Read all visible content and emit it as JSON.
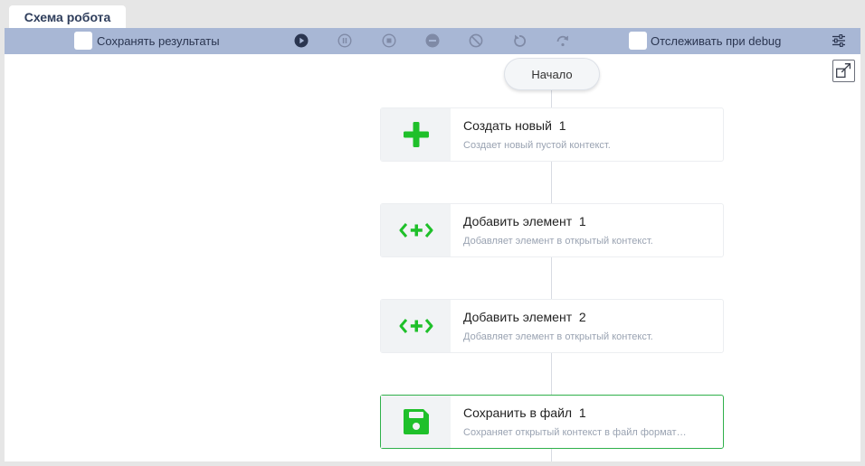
{
  "tab": {
    "label": "Схема робота"
  },
  "toolbar": {
    "save_results_label": "Сохранять результаты",
    "track_debug_label": "Отслеживать при debug",
    "buttons": [
      {
        "icon": "play-icon"
      },
      {
        "icon": "pause-icon"
      },
      {
        "icon": "stop-icon"
      },
      {
        "icon": "minus-circle-icon"
      },
      {
        "icon": "block-icon"
      },
      {
        "icon": "undo-icon"
      },
      {
        "icon": "redo-icon"
      },
      {
        "icon": "settings-sliders-icon"
      }
    ]
  },
  "flow": {
    "start_label": "Начало",
    "nodes": [
      {
        "title": "Создать новый  1",
        "desc": "Создает новый пустой контекст.",
        "icon": "plus-icon"
      },
      {
        "title": "Добавить элемент  1",
        "desc": "Добавляет элемент в открытый контекст.",
        "icon": "add-element-icon"
      },
      {
        "title": "Добавить элемент  2",
        "desc": "Добавляет элемент в открытый контекст.",
        "icon": "add-element-icon"
      },
      {
        "title": "Сохранить в файл  1",
        "desc": "Сохраняет открытый контекст в файл формат…",
        "icon": "save-disk-icon"
      }
    ]
  },
  "colors": {
    "accent_green": "#1fc02a",
    "toolbar_bg": "#a8b7d5",
    "icon_dark": "#2a3550"
  }
}
